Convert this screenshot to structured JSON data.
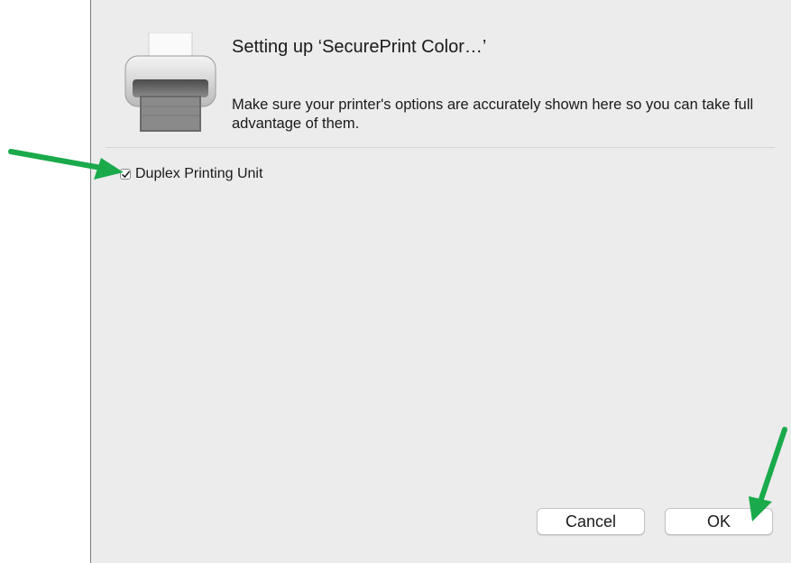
{
  "dialog": {
    "title": "Setting up ‘SecurePrint Color…’",
    "message": "Make sure your printer's options are accurately shown here so you can take full advantage of them.",
    "icon": "printer-icon"
  },
  "options": [
    {
      "label": "Duplex Printing Unit",
      "checked": true
    }
  ],
  "buttons": {
    "cancel_label": "Cancel",
    "ok_label": "OK"
  },
  "annotations": {
    "arrow_color": "#1aaa4b",
    "arrows": [
      "arrow-to-duplex-checkbox",
      "arrow-to-ok-button"
    ]
  }
}
